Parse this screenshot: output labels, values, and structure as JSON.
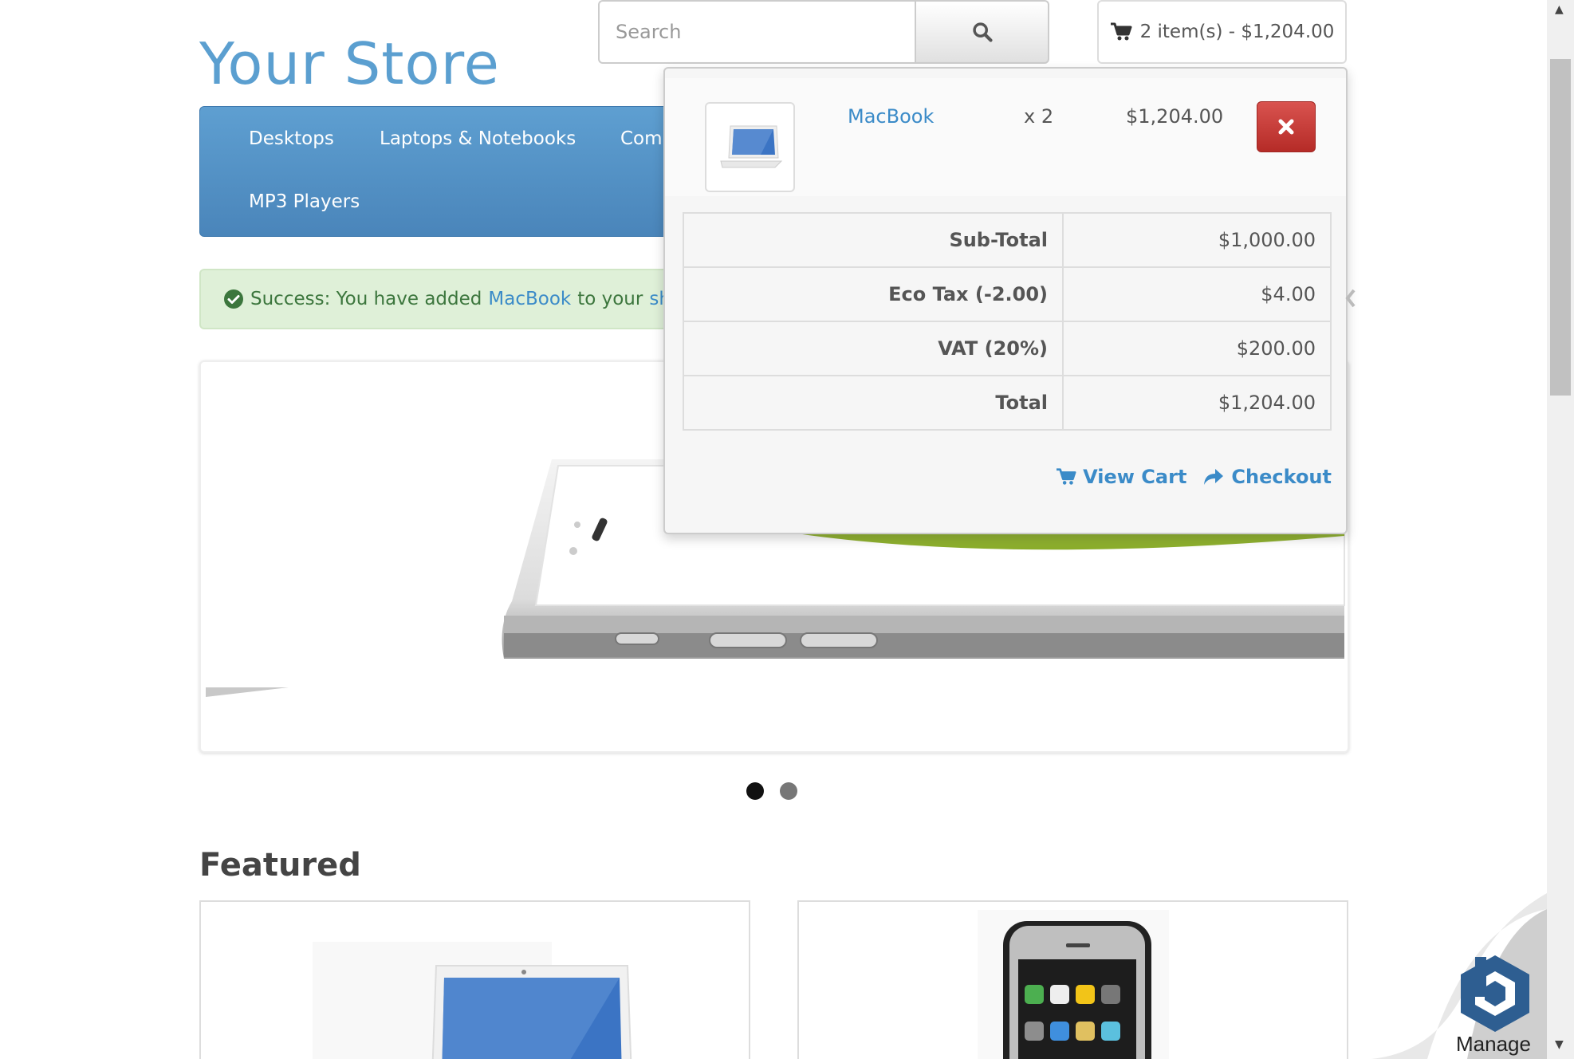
{
  "header": {
    "store_name": "Your Store",
    "search_placeholder": "Search",
    "cart_summary": "2 item(s) - $1,204.00"
  },
  "menu": {
    "items": [
      "Desktops",
      "Laptops & Notebooks",
      "Comp",
      "MP3 Players"
    ]
  },
  "alert": {
    "prefix": "Success: You have added",
    "product": "MacBook",
    "middle": "to your",
    "tail": "sho"
  },
  "slideshow": {
    "active_dot": 1,
    "dot_count": 2
  },
  "featured": {
    "title": "Featured"
  },
  "cart_dropdown": {
    "product_name": "MacBook",
    "quantity": "x 2",
    "price": "$1,204.00",
    "totals": [
      {
        "label": "Sub-Total",
        "value": "$1,000.00"
      },
      {
        "label": "Eco Tax (-2.00)",
        "value": "$4.00"
      },
      {
        "label": "VAT (20%)",
        "value": "$200.00"
      },
      {
        "label": "Total",
        "value": "$1,204.00"
      }
    ],
    "view_cart": "View Cart",
    "checkout": "Checkout"
  },
  "widget": {
    "label": "Manage"
  },
  "colors": {
    "brand_blue": "#5b9fd0",
    "danger_red": "#c9302c",
    "success_bg": "#dff0d8"
  }
}
